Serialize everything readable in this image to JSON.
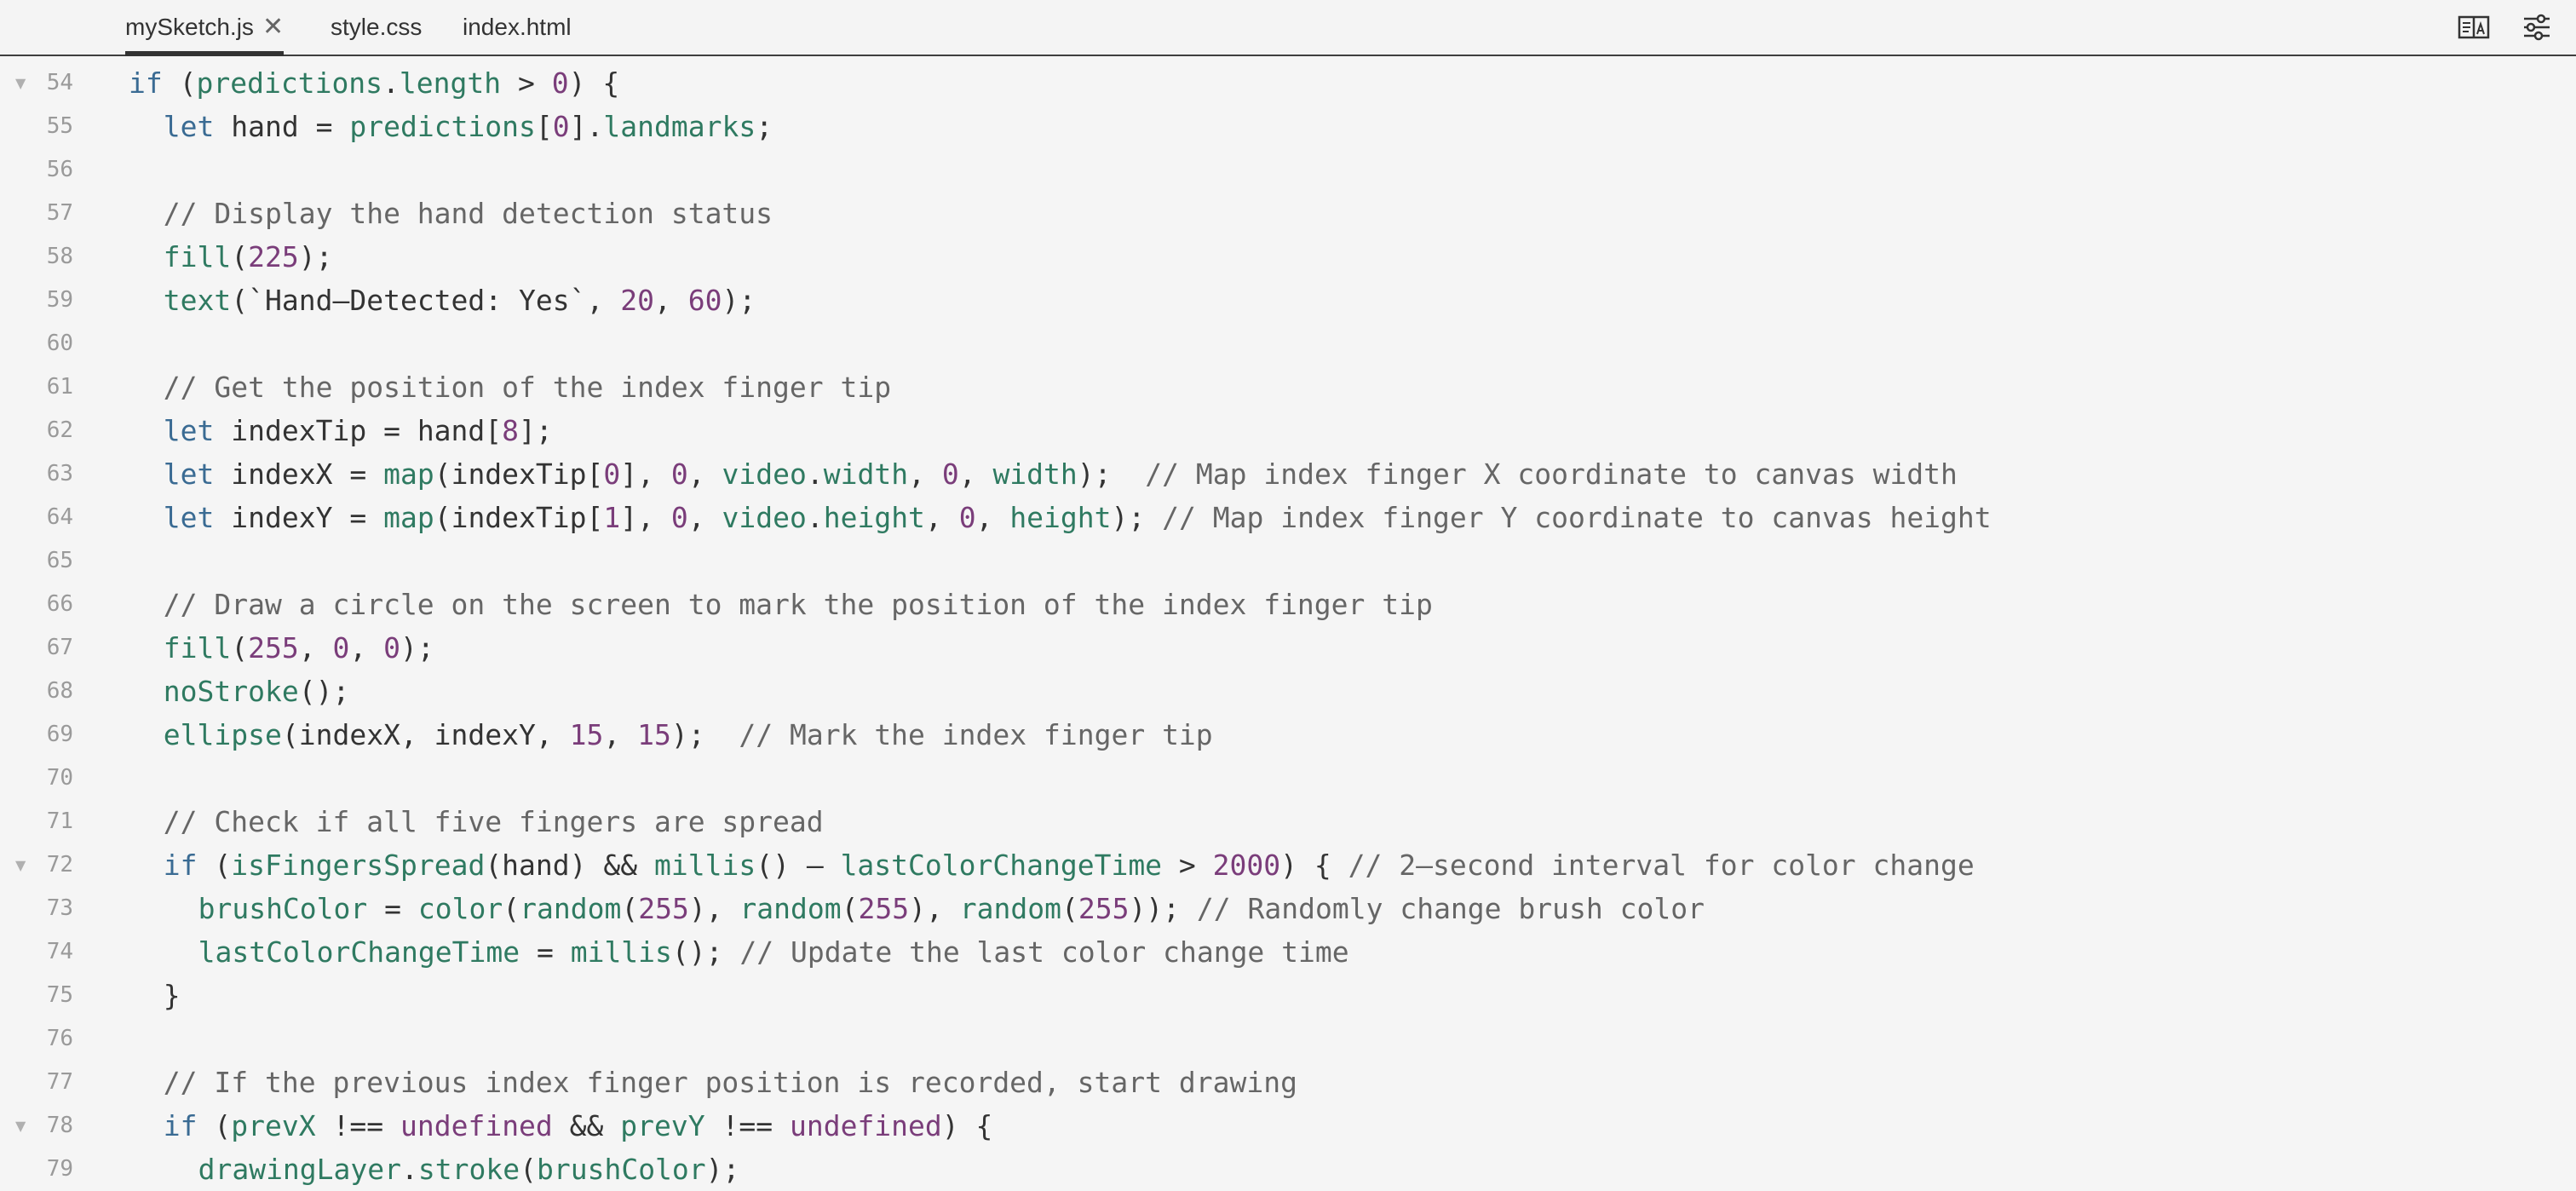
{
  "tabs": [
    {
      "label": "mySketch.js",
      "active": true,
      "closable": true
    },
    {
      "label": "style.css",
      "active": false
    },
    {
      "label": "index.html",
      "active": false
    }
  ],
  "toolbar": {
    "icons": [
      "layout-toggle-icon",
      "settings-sliders-icon"
    ]
  },
  "colors": {
    "keyword": "#3a6b93",
    "function": "#2f7a61",
    "number": "#7a3d7a",
    "comment": "#666666",
    "text": "#333333"
  },
  "editor": {
    "lines": [
      {
        "n": "54",
        "fold": true,
        "indent": 2,
        "segs": [
          [
            "kw",
            "if"
          ],
          [
            "t",
            " ("
          ],
          [
            "pp",
            "predictions"
          ],
          [
            "t",
            "."
          ],
          [
            "pp",
            "length"
          ],
          [
            "t",
            " > "
          ],
          [
            "num",
            "0"
          ],
          [
            "t",
            ") {"
          ]
        ]
      },
      {
        "n": "55",
        "indent": 4,
        "segs": [
          [
            "kw",
            "let"
          ],
          [
            "t",
            " hand = "
          ],
          [
            "pp",
            "predictions"
          ],
          [
            "t",
            "["
          ],
          [
            "num",
            "0"
          ],
          [
            "t",
            "]."
          ],
          [
            "pp",
            "landmarks"
          ],
          [
            "t",
            ";"
          ]
        ]
      },
      {
        "n": "56",
        "indent": 0,
        "segs": []
      },
      {
        "n": "57",
        "indent": 4,
        "segs": [
          [
            "cm",
            "// Display the hand detection status"
          ]
        ]
      },
      {
        "n": "58",
        "indent": 4,
        "segs": [
          [
            "fn",
            "fill"
          ],
          [
            "t",
            "("
          ],
          [
            "num",
            "225"
          ],
          [
            "t",
            ");"
          ]
        ]
      },
      {
        "n": "59",
        "indent": 4,
        "segs": [
          [
            "fn",
            "text"
          ],
          [
            "t",
            "(`Hand—Detected: Yes`, "
          ],
          [
            "num",
            "20"
          ],
          [
            "t",
            ", "
          ],
          [
            "num",
            "60"
          ],
          [
            "t",
            ");"
          ]
        ]
      },
      {
        "n": "60",
        "indent": 0,
        "segs": []
      },
      {
        "n": "61",
        "indent": 4,
        "segs": [
          [
            "cm",
            "// Get the position of the index finger tip"
          ]
        ]
      },
      {
        "n": "62",
        "indent": 4,
        "segs": [
          [
            "kw",
            "let"
          ],
          [
            "t",
            " indexTip = hand["
          ],
          [
            "num",
            "8"
          ],
          [
            "t",
            "];"
          ]
        ]
      },
      {
        "n": "63",
        "indent": 4,
        "segs": [
          [
            "kw",
            "let"
          ],
          [
            "t",
            " indexX = "
          ],
          [
            "fn",
            "map"
          ],
          [
            "t",
            "(indexTip["
          ],
          [
            "num",
            "0"
          ],
          [
            "t",
            "], "
          ],
          [
            "num",
            "0"
          ],
          [
            "t",
            ", "
          ],
          [
            "pp",
            "video"
          ],
          [
            "t",
            "."
          ],
          [
            "pp",
            "width"
          ],
          [
            "t",
            ", "
          ],
          [
            "num",
            "0"
          ],
          [
            "t",
            ", "
          ],
          [
            "pp",
            "width"
          ],
          [
            "t",
            ");  "
          ],
          [
            "cm",
            "// Map index finger X coordinate to canvas width"
          ]
        ]
      },
      {
        "n": "64",
        "indent": 4,
        "segs": [
          [
            "kw",
            "let"
          ],
          [
            "t",
            " indexY = "
          ],
          [
            "fn",
            "map"
          ],
          [
            "t",
            "(indexTip["
          ],
          [
            "num",
            "1"
          ],
          [
            "t",
            "], "
          ],
          [
            "num",
            "0"
          ],
          [
            "t",
            ", "
          ],
          [
            "pp",
            "video"
          ],
          [
            "t",
            "."
          ],
          [
            "pp",
            "height"
          ],
          [
            "t",
            ", "
          ],
          [
            "num",
            "0"
          ],
          [
            "t",
            ", "
          ],
          [
            "pp",
            "height"
          ],
          [
            "t",
            "); "
          ],
          [
            "cm",
            "// Map index finger Y coordinate to canvas height"
          ]
        ]
      },
      {
        "n": "65",
        "indent": 0,
        "segs": []
      },
      {
        "n": "66",
        "indent": 4,
        "segs": [
          [
            "cm",
            "// Draw a circle on the screen to mark the position of the index finger tip"
          ]
        ]
      },
      {
        "n": "67",
        "indent": 4,
        "segs": [
          [
            "fn",
            "fill"
          ],
          [
            "t",
            "("
          ],
          [
            "num",
            "255"
          ],
          [
            "t",
            ", "
          ],
          [
            "num",
            "0"
          ],
          [
            "t",
            ", "
          ],
          [
            "num",
            "0"
          ],
          [
            "t",
            ");"
          ]
        ]
      },
      {
        "n": "68",
        "indent": 4,
        "segs": [
          [
            "fn",
            "noStroke"
          ],
          [
            "t",
            "();"
          ]
        ]
      },
      {
        "n": "69",
        "indent": 4,
        "segs": [
          [
            "fn",
            "ellipse"
          ],
          [
            "t",
            "(indexX, indexY, "
          ],
          [
            "num",
            "15"
          ],
          [
            "t",
            ", "
          ],
          [
            "num",
            "15"
          ],
          [
            "t",
            ");  "
          ],
          [
            "cm",
            "// Mark the index finger tip"
          ]
        ]
      },
      {
        "n": "70",
        "indent": 0,
        "segs": []
      },
      {
        "n": "71",
        "indent": 4,
        "segs": [
          [
            "cm",
            "// Check if all five fingers are spread"
          ]
        ]
      },
      {
        "n": "72",
        "fold": true,
        "indent": 4,
        "segs": [
          [
            "kw",
            "if"
          ],
          [
            "t",
            " ("
          ],
          [
            "fn",
            "isFingersSpread"
          ],
          [
            "t",
            "(hand) && "
          ],
          [
            "fn",
            "millis"
          ],
          [
            "t",
            "() — "
          ],
          [
            "pp",
            "lastColorChangeTime"
          ],
          [
            "t",
            " > "
          ],
          [
            "num",
            "2000"
          ],
          [
            "t",
            ") { "
          ],
          [
            "cm",
            "// 2—second interval for color change"
          ]
        ]
      },
      {
        "n": "73",
        "indent": 6,
        "segs": [
          [
            "pp",
            "brushColor"
          ],
          [
            "t",
            " = "
          ],
          [
            "fn",
            "color"
          ],
          [
            "t",
            "("
          ],
          [
            "fn",
            "random"
          ],
          [
            "t",
            "("
          ],
          [
            "num",
            "255"
          ],
          [
            "t",
            "), "
          ],
          [
            "fn",
            "random"
          ],
          [
            "t",
            "("
          ],
          [
            "num",
            "255"
          ],
          [
            "t",
            "), "
          ],
          [
            "fn",
            "random"
          ],
          [
            "t",
            "("
          ],
          [
            "num",
            "255"
          ],
          [
            "t",
            "));"
          ],
          [
            "t",
            " "
          ],
          [
            "cm",
            "// Randomly change brush color"
          ]
        ]
      },
      {
        "n": "74",
        "indent": 6,
        "segs": [
          [
            "pp",
            "lastColorChangeTime"
          ],
          [
            "t",
            " = "
          ],
          [
            "fn",
            "millis"
          ],
          [
            "t",
            "(); "
          ],
          [
            "cm",
            "// Update the last color change time"
          ]
        ]
      },
      {
        "n": "75",
        "indent": 4,
        "segs": [
          [
            "t",
            "}"
          ]
        ]
      },
      {
        "n": "76",
        "indent": 0,
        "segs": []
      },
      {
        "n": "77",
        "indent": 4,
        "segs": [
          [
            "cm",
            "// If the previous index finger position is recorded, start drawing"
          ]
        ]
      },
      {
        "n": "78",
        "fold": true,
        "indent": 4,
        "segs": [
          [
            "kw",
            "if"
          ],
          [
            "t",
            " ("
          ],
          [
            "pp",
            "prevX"
          ],
          [
            "t",
            " !== "
          ],
          [
            "undef",
            "undefined"
          ],
          [
            "t",
            " && "
          ],
          [
            "pp",
            "prevY"
          ],
          [
            "t",
            " !== "
          ],
          [
            "undef",
            "undefined"
          ],
          [
            "t",
            ") {"
          ]
        ]
      },
      {
        "n": "79",
        "indent": 6,
        "segs": [
          [
            "pp",
            "drawingLayer"
          ],
          [
            "t",
            "."
          ],
          [
            "fn",
            "stroke"
          ],
          [
            "t",
            "("
          ],
          [
            "pp",
            "brushColor"
          ],
          [
            "t",
            ");"
          ]
        ]
      }
    ]
  }
}
